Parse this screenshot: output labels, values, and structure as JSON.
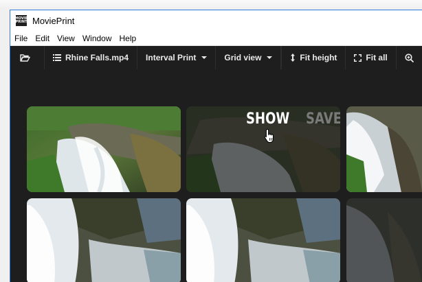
{
  "window": {
    "title": "MoviePrint",
    "app_icon_lines": [
      "MOVIE",
      "PRINT"
    ]
  },
  "menubar": {
    "items": [
      "File",
      "Edit",
      "View",
      "Window",
      "Help"
    ]
  },
  "toolbar": {
    "open_icon": "folder-open-icon",
    "file_label": "Rhine Falls.mp4",
    "print_mode_label": "Interval Print",
    "view_mode_label": "Grid view",
    "fit_height_label": "Fit height",
    "fit_all_label": "Fit all",
    "zoom_icon": "zoom-in-icon"
  },
  "thumbnail_overlay": {
    "show_label": "SHOW",
    "save_label": "SAVE"
  },
  "colors": {
    "window_bg": "#1e1e1e",
    "titlebar_bg": "#ffffff",
    "window_border": "#2b79d8",
    "toolbar_text": "#eaeaea"
  }
}
